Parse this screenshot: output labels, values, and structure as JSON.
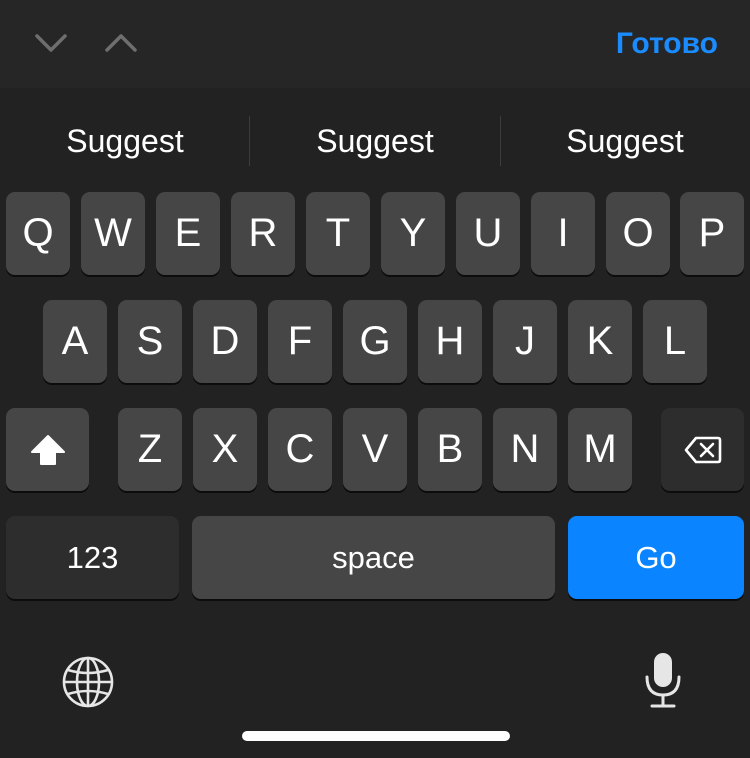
{
  "toolbar": {
    "done_label": "Готово",
    "prev_icon": "chevron-down-icon",
    "next_icon": "chevron-up-icon",
    "accent_color": "#1a8cff"
  },
  "suggestions": [
    "Suggest",
    "Suggest",
    "Suggest"
  ],
  "rows": [
    [
      "Q",
      "W",
      "E",
      "R",
      "T",
      "Y",
      "U",
      "I",
      "O",
      "P"
    ],
    [
      "A",
      "S",
      "D",
      "F",
      "G",
      "H",
      "J",
      "K",
      "L"
    ],
    [
      "Z",
      "X",
      "C",
      "V",
      "B",
      "N",
      "M"
    ]
  ],
  "special": {
    "shift_icon": "shift-icon",
    "backspace_icon": "backspace-icon",
    "numbers_label": "123",
    "space_label": "space",
    "go_label": "Go",
    "globe_icon": "globe-icon",
    "mic_icon": "microphone-icon"
  }
}
